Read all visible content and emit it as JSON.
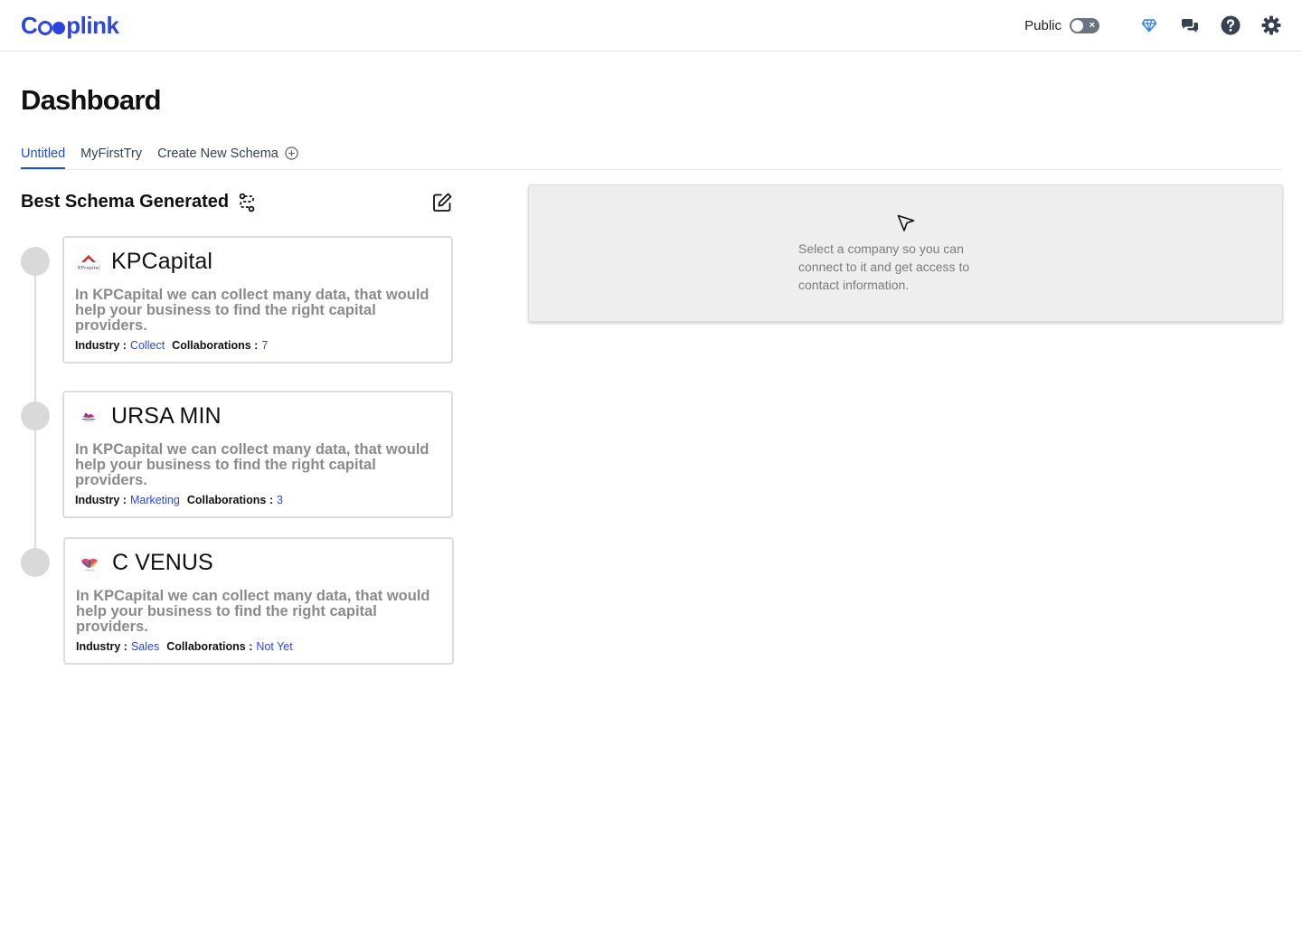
{
  "app": {
    "logo_text_start": "C",
    "logo_text_end": "plink"
  },
  "topbar": {
    "public_label": "Public",
    "toggle_state": "off",
    "icons": [
      "diamond-icon",
      "chat-icon",
      "help-icon",
      "settings-icon"
    ]
  },
  "page": {
    "title": "Dashboard"
  },
  "tabs": [
    {
      "label": "Untitled",
      "active": true
    },
    {
      "label": "MyFirstTry",
      "active": false
    },
    {
      "label": "Create New Schema",
      "active": false
    }
  ],
  "section": {
    "title": "Best Schema Generated"
  },
  "companies": [
    {
      "name": "KPCapital",
      "logo": "kpcapital-logo",
      "description": "In KPCapital we can collect many data, that would help your business to find the right capital providers.",
      "industry_label": "Industry :",
      "industry": "Collect",
      "collaborations_label": "Collaborations :",
      "collaborations": "7"
    },
    {
      "name": "URSA MIN",
      "logo": "ursa-min-logo",
      "description": "In KPCapital we can collect many data, that would help your business to find the right capital providers.",
      "industry_label": "Industry :",
      "industry": "Marketing",
      "collaborations_label": "Collaborations :",
      "collaborations": "3"
    },
    {
      "name": "C VENUS",
      "logo": "c-venus-logo",
      "description": "In KPCapital we can collect many data, that would help your business to find the right capital providers.",
      "industry_label": "Industry :",
      "industry": "Sales",
      "collaborations_label": "Collaborations :",
      "collaborations": "Not Yet"
    }
  ],
  "info_panel": {
    "message": "Select a company so you can connect to it and get access to contact information."
  },
  "colors": {
    "brand": "#2b46e0",
    "active_tab": "#1d4ed8",
    "muted_text": "#8a8a8a",
    "panel_bg": "#eeeeee"
  }
}
